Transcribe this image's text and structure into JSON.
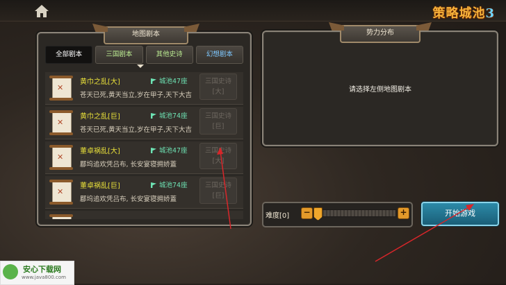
{
  "logo": {
    "text": "策略城池",
    "number": "3"
  },
  "map_panel": {
    "title": "地图剧本",
    "tabs": [
      {
        "label": "全部剧本"
      },
      {
        "label": "三国剧本"
      },
      {
        "label": "其他史诗"
      },
      {
        "label": "幻想剧本"
      }
    ],
    "active_tab": "全部剧本",
    "items": [
      {
        "name": "黄巾之乱[大]",
        "cities": "城池47座",
        "desc": "苍天已死,黄天当立,岁在甲子,天下大吉",
        "button": "三国史诗 [大]"
      },
      {
        "name": "黄巾之乱[巨]",
        "cities": "城池74座",
        "desc": "苍天已死,黄天当立,岁在甲子,天下大吉",
        "button": "三国史诗 [巨]"
      },
      {
        "name": "董卓祸乱[大]",
        "cities": "城池47座",
        "desc": "郿坞追欢凭吕布, 长安宴寝拥娇蓋",
        "button": "三国史诗 [大]"
      },
      {
        "name": "董卓祸乱[巨]",
        "cities": "城池74座",
        "desc": "郿坞追欢凭吕布, 长安宴寝拥娇蓋",
        "button": "三国史诗 [巨]"
      }
    ]
  },
  "force_panel": {
    "title": "势力分布",
    "hint": "请选择左侧地图剧本"
  },
  "difficulty": {
    "label": "难度[0]",
    "minus": "−",
    "plus": "+",
    "level_fraction": 0.0
  },
  "start_button": {
    "label": "开始游戏"
  },
  "watermark": {
    "title": "安心下载网",
    "url": "www.java800.com"
  },
  "colors": {
    "name": "#e9e03a",
    "cities": "#6ee3b4",
    "start": "#2c8aa8",
    "accent": "#e49a2a"
  }
}
